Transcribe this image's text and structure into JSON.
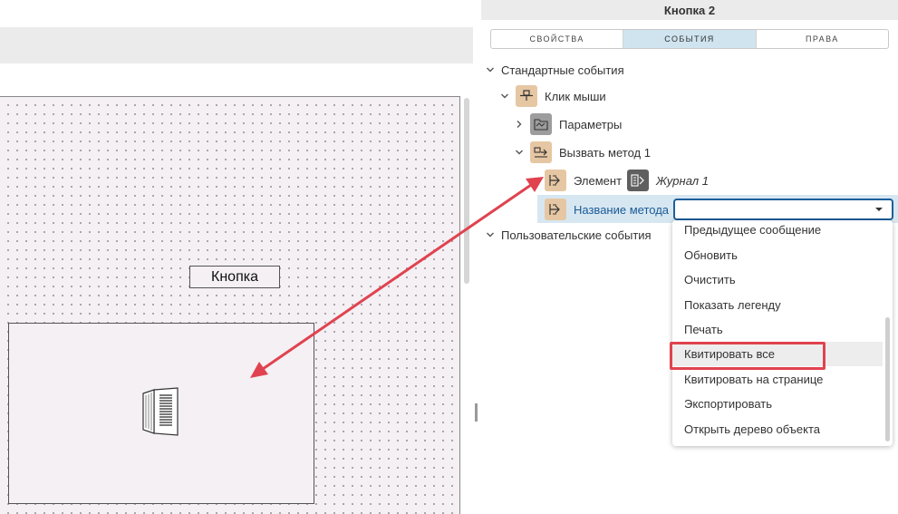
{
  "canvas": {
    "button_label": "Кнопка"
  },
  "panel": {
    "title": "Кнопка 2",
    "tabs": [
      {
        "label": "СВОЙСТВА",
        "active": false
      },
      {
        "label": "СОБЫТИЯ",
        "active": true
      },
      {
        "label": "ПРАВА",
        "active": false
      }
    ]
  },
  "tree": {
    "standard_events": "Стандартные события",
    "mouse_click": "Клик мыши",
    "parameters": "Параметры",
    "call_method": "Вызвать метод 1",
    "element_label": "Элемент",
    "element_value": "Журнал 1",
    "method_name_label": "Название метода",
    "method_name_value": "",
    "user_events": "Пользовательские события"
  },
  "dropdown": {
    "options": [
      "Предыдущее сообщение",
      "Обновить",
      "Очистить",
      "Показать легенду",
      "Печать",
      "Квитировать все",
      "Квитировать на странице",
      "Экспортировать",
      "Открыть дерево объекта"
    ],
    "hovered_option": "Квитировать все"
  },
  "colors": {
    "accent": "#1d5e9a",
    "tab_active_bg": "#cfe4ef",
    "annotation_red": "#e0434f",
    "node_icon_orange": "#e6c7a3"
  },
  "icons": {
    "expand": "chevron-down-icon",
    "collapse": "chevron-right-icon",
    "mouse_click": "flowchart-node-icon",
    "parameters": "folder-icon",
    "call_method": "method-call-icon",
    "element": "flow-arrows-icon",
    "journal": "journal-icon"
  }
}
